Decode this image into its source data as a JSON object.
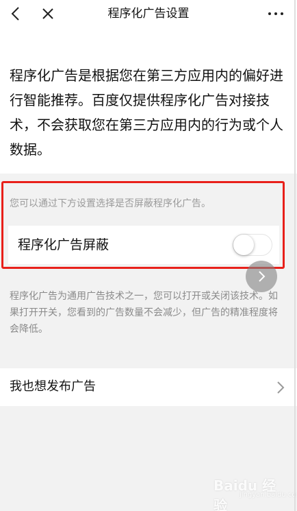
{
  "header": {
    "title": "程序化广告设置"
  },
  "intro": {
    "text": "程序化广告是根据您在第三方应用内的偏好进行智能推荐。百度仅提供程序化广告对接技术，不会获取您在第三方应用内的行为或个人数据。"
  },
  "settings": {
    "hint": "您可以通过下方设置选择是否屏蔽程序化广告。",
    "toggle_label": "程序化广告屏蔽",
    "toggle_state": "off"
  },
  "description": "程序化广告为通用广告技术之一，您可以打开或关闭该技术。如果打开开关，您看到的广告数量不会减少，但广告的精准程度将会降低。",
  "publish": {
    "label": "我也想发布广告"
  },
  "watermark": {
    "brand": "Baidu 经验",
    "url": "jingyan.baidu.com"
  },
  "colors": {
    "highlight": "#e8201a",
    "background": "#f2f2f2",
    "text": "#111111",
    "hint": "#9a9a9a"
  },
  "icons": [
    "back-icon",
    "close-icon",
    "more-icon",
    "chevron-right-icon"
  ]
}
